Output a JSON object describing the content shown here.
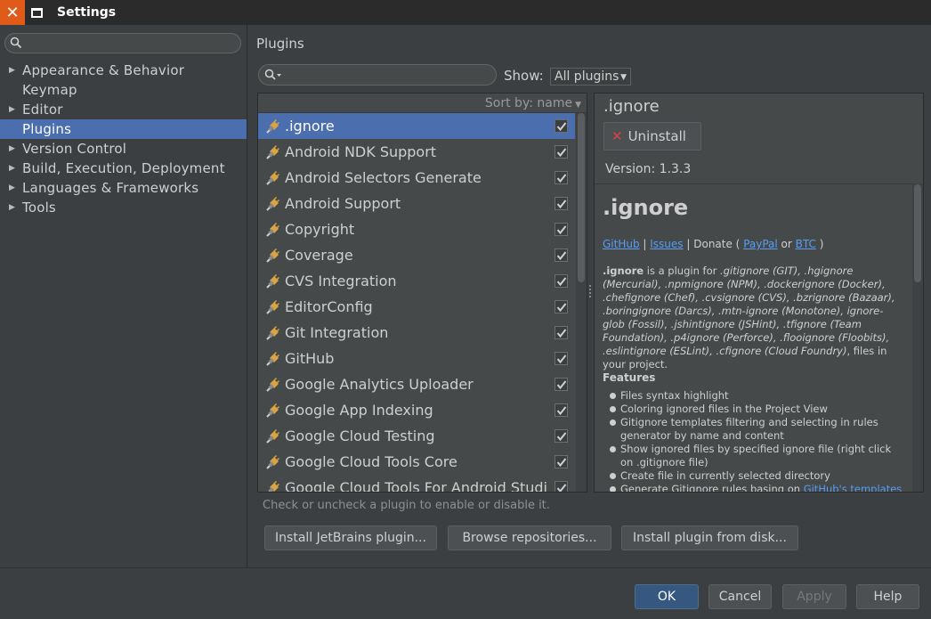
{
  "window": {
    "title": "Settings"
  },
  "sidebar": {
    "search_placeholder": "",
    "items": [
      {
        "label": "Appearance & Behavior",
        "expandable": true,
        "selected": false
      },
      {
        "label": "Keymap",
        "expandable": false,
        "selected": false
      },
      {
        "label": "Editor",
        "expandable": true,
        "selected": false
      },
      {
        "label": "Plugins",
        "expandable": false,
        "selected": true
      },
      {
        "label": "Version Control",
        "expandable": true,
        "selected": false
      },
      {
        "label": "Build, Execution, Deployment",
        "expandable": true,
        "selected": false
      },
      {
        "label": "Languages & Frameworks",
        "expandable": true,
        "selected": false
      },
      {
        "label": "Tools",
        "expandable": true,
        "selected": false
      }
    ]
  },
  "main": {
    "title": "Plugins",
    "search_placeholder": "",
    "show_label": "Show:",
    "show_value": "All plugins",
    "sort_label": "Sort by: name",
    "plugins": [
      {
        "name": ".ignore",
        "checked": true,
        "selected": true
      },
      {
        "name": "Android NDK Support",
        "checked": true,
        "selected": false
      },
      {
        "name": "Android Selectors Generate",
        "checked": true,
        "selected": false
      },
      {
        "name": "Android Support",
        "checked": true,
        "selected": false
      },
      {
        "name": "Copyright",
        "checked": true,
        "selected": false
      },
      {
        "name": "Coverage",
        "checked": true,
        "selected": false
      },
      {
        "name": "CVS Integration",
        "checked": true,
        "selected": false
      },
      {
        "name": "EditorConfig",
        "checked": true,
        "selected": false
      },
      {
        "name": "Git Integration",
        "checked": true,
        "selected": false
      },
      {
        "name": "GitHub",
        "checked": true,
        "selected": false
      },
      {
        "name": "Google Analytics Uploader",
        "checked": true,
        "selected": false
      },
      {
        "name": "Google App Indexing",
        "checked": true,
        "selected": false
      },
      {
        "name": "Google Cloud Testing",
        "checked": true,
        "selected": false
      },
      {
        "name": "Google Cloud Tools Core",
        "checked": true,
        "selected": false
      },
      {
        "name": "Google Cloud Tools For Android Studio",
        "checked": true,
        "selected": false
      }
    ],
    "hint": "Check or uncheck a plugin to enable or disable it.",
    "buttons": {
      "install_jetbrains": "Install JetBrains plugin...",
      "browse": "Browse repositories...",
      "install_disk": "Install plugin from disk..."
    }
  },
  "details": {
    "title": ".ignore",
    "uninstall_label": "Uninstall",
    "version": "Version: 1.3.3",
    "heading": ".ignore",
    "links": {
      "github": "GitHub",
      "sep1": " | ",
      "issues": "Issues",
      "donate": " | Donate ( ",
      "paypal": "PayPal",
      "or": " or ",
      "btc": "BTC",
      "close": " )"
    },
    "desc_name": ".ignore",
    "desc_text1": " is a plugin for ",
    "desc_files": ".gitignore (GIT), .hgignore (Mercurial), .npmignore (NPM), .dockerignore (Docker), .chefignore (Chef), .cvsignore (CVS), .bzrignore (Bazaar), .boringignore (Darcs), .mtn-ignore (Monotone), ignore-glob (Fossil), .jshintignore (JSHint), .tfignore (Team Foundation), .p4ignore (Perforce), .flooignore (Floobits), .eslintignore (ESLint), .cfignore (Cloud Foundry)",
    "desc_text2": ", files in your project.",
    "features_label": "Features",
    "features": [
      "Files syntax highlight",
      "Coloring ignored files in the Project View",
      "Gitignore templates filtering and selecting in rules generator by name and content",
      "Show ignored files by specified ignore file (right click on .gitignore file)",
      "Create file in currently selected directory"
    ],
    "feature_last_text": "Generate Gitignore rules basing on ",
    "feature_last_link": "GitHub's templates"
  },
  "footer": {
    "ok": "OK",
    "cancel": "Cancel",
    "apply": "Apply",
    "help": "Help"
  },
  "colors": {
    "accent": "#4b6eaf",
    "background": "#3c3f41",
    "close": "#e05a1a",
    "link": "#589df6"
  }
}
